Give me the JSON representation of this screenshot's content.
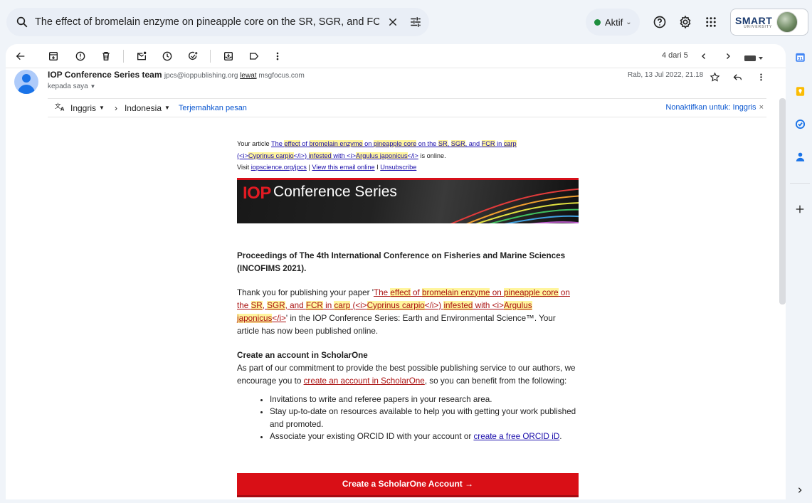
{
  "search": {
    "query": "The effect of bromelain enzyme on pineapple core on the SR, SGR, and FCR  in c"
  },
  "status": {
    "label": "Aktif"
  },
  "org": {
    "logo_text": "SMART",
    "logo_sub": "UNIVERSITY"
  },
  "pager": {
    "label": "4 dari 5"
  },
  "sender": {
    "name": "IOP Conference Series team",
    "email": "jpcs@ioppublishing.org",
    "via_label": "lewat",
    "via": "msgfocus.com",
    "to": "kepada saya",
    "date": "Rab, 13 Jul 2022, 21.18"
  },
  "translate": {
    "from": "Inggris",
    "to": "Indonesia",
    "link": "Terjemahkan pesan",
    "disable": "Nonaktifkan untuk: Inggris"
  },
  "email": {
    "pre_1": "Your article ",
    "pre_title_a": "The ",
    "pre_title_b": "effect",
    "pre_title_c": " of ",
    "pre_title_d": "bromelain enzyme",
    "pre_title_e": " on ",
    "pre_title_f": "pineapple core",
    "pre_title_g": " on the ",
    "pre_title_h": "SR",
    "pre_title_i": ", ",
    "pre_title_j": "SGR",
    "pre_title_k": ", and ",
    "pre_title_l": "FCR",
    "pre_title_m": " in ",
    "pre_title_n": "carp",
    "pre_title_o": "(<i>",
    "pre_title_p": "Cyprinus carpio",
    "pre_title_q": "</i>) ",
    "pre_title_r": "infested",
    "pre_title_s": " with <i>",
    "pre_title_t": "Argulus japonicus",
    "pre_title_u": "</i>",
    "pre_2": " is online.",
    "visit": "Visit ",
    "visit_link": "iopscience.org/jpcs",
    "sep1": " | ",
    "view_online": "View this email online",
    "sep2": " I ",
    "unsubscribe": "Unsubscribe",
    "banner_iop": "IOP",
    "banner_cs": "Conference Series",
    "proceedings": "Proceedings of The 4th International Conference on Fisheries and Marine Sciences (INCOFIMS 2021).",
    "thanks_1": "Thank you for publishing your paper '",
    "t_a": "The ",
    "t_b": "effect",
    "t_c": " of ",
    "t_d": "bromelain enzyme",
    "t_e": " on ",
    "t_f": "pineapple core",
    "t_g": " on the ",
    "t_h": "SR",
    "t_i": ", ",
    "t_j": "SGR",
    "t_k": ", and ",
    "t_l": "FCR",
    "t_m": " in ",
    "t_n": "carp",
    "t_o": " (<i>",
    "t_p": "Cyprinus carpio",
    "t_q": "</i>) ",
    "t_r": "infested",
    "t_s": " with <i>",
    "t_t": "Argulus japonicus",
    "t_u": "</i>",
    "thanks_2": "' in the IOP Conference Series: Earth and Environmental Science™. Your article has now been published online.",
    "create_heading": "Create an account in ScholarOne",
    "create_1": "As part of our commitment to provide the best possible publishing service to our authors, we encourage you to ",
    "create_link": "create an account in ScholarOne",
    "create_2": ", so you can benefit from the following:",
    "bullet_1": "Invitations to write and referee papers in your research area.",
    "bullet_2": "Stay up-to-date on resources available to help you with getting your work published and promoted.",
    "bullet_3": "Associate your existing ORCID ID with your account or ",
    "bullet_3_link": "create a free ORCID iD",
    "bullet_3_end": ".",
    "cta": "Create a ScholarOne Account →"
  },
  "colors": {
    "accent": "#d90f16",
    "link": "#1a0dab",
    "highlight": "#fff59d"
  }
}
